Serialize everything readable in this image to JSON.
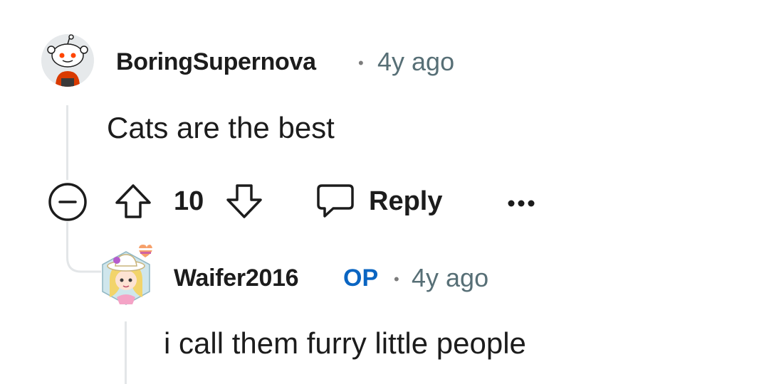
{
  "comments": [
    {
      "username": "BoringSupernova",
      "separator": "•",
      "time": "4y ago",
      "body": "Cats are the best",
      "score": "10",
      "reply_label": "Reply",
      "more_label": "•••"
    },
    {
      "username": "Waifer2016",
      "op_badge": "OP",
      "separator": "•",
      "time": "4y ago",
      "body": "i call them furry little people"
    }
  ],
  "colors": {
    "text": "#1c1c1c",
    "meta": "#576f76",
    "op": "#0a65c2",
    "thread_line": "#e3e6e8"
  },
  "icons": [
    "snoo-avatar",
    "anime-avatar",
    "collapse-icon",
    "upvote-icon",
    "downvote-icon",
    "reply-icon",
    "more-icon"
  ]
}
